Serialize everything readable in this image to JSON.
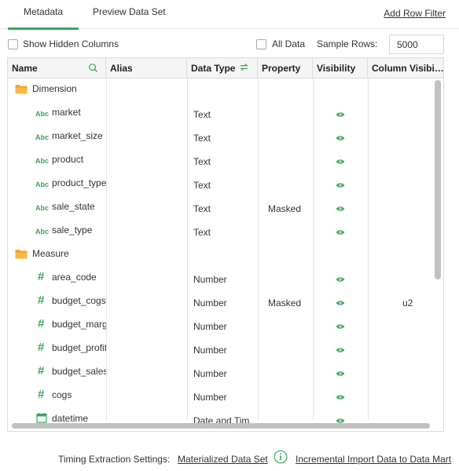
{
  "tabs": {
    "metadata": "Metadata",
    "preview": "Preview Data Set"
  },
  "add_row_filter": "Add Row Filter",
  "options": {
    "show_hidden_columns": "Show Hidden Columns",
    "all_data": "All Data",
    "sample_rows_label": "Sample Rows:",
    "sample_rows_value": "5000"
  },
  "columns": {
    "name": "Name",
    "alias": "Alias",
    "data_type": "Data Type",
    "property": "Property",
    "visibility": "Visibility",
    "column_visibility": "Column Visibi…"
  },
  "rows": [
    {
      "kind": "folder",
      "name": "Dimension"
    },
    {
      "kind": "field",
      "icon": "Abc",
      "name": "market",
      "type": "Text",
      "property": "",
      "visible": true,
      "column_visibility": ""
    },
    {
      "kind": "field",
      "icon": "Abc",
      "name": "market_size",
      "type": "Text",
      "property": "",
      "visible": true,
      "column_visibility": ""
    },
    {
      "kind": "field",
      "icon": "Abc",
      "name": "product",
      "type": "Text",
      "property": "",
      "visible": true,
      "column_visibility": ""
    },
    {
      "kind": "field",
      "icon": "Abc",
      "name": "product_type",
      "type": "Text",
      "property": "",
      "visible": true,
      "column_visibility": ""
    },
    {
      "kind": "field",
      "icon": "Abc",
      "name": "sale_state",
      "type": "Text",
      "property": "Masked",
      "visible": true,
      "column_visibility": ""
    },
    {
      "kind": "field",
      "icon": "Abc",
      "name": "sale_type",
      "type": "Text",
      "property": "",
      "visible": true,
      "column_visibility": ""
    },
    {
      "kind": "folder",
      "name": "Measure"
    },
    {
      "kind": "field",
      "icon": "#",
      "name": "area_code",
      "type": "Number",
      "property": "",
      "visible": true,
      "column_visibility": ""
    },
    {
      "kind": "field",
      "icon": "#",
      "name": "budget_cogs",
      "type": "Number",
      "property": "Masked",
      "visible": true,
      "column_visibility": "u2"
    },
    {
      "kind": "field",
      "icon": "#",
      "name": "budget_marg",
      "type": "Number",
      "property": "",
      "visible": true,
      "column_visibility": ""
    },
    {
      "kind": "field",
      "icon": "#",
      "name": "budget_profit",
      "type": "Number",
      "property": "",
      "visible": true,
      "column_visibility": ""
    },
    {
      "kind": "field",
      "icon": "#",
      "name": "budget_sales",
      "type": "Number",
      "property": "",
      "visible": true,
      "column_visibility": ""
    },
    {
      "kind": "field",
      "icon": "#",
      "name": "cogs",
      "type": "Number",
      "property": "",
      "visible": true,
      "column_visibility": ""
    },
    {
      "kind": "field",
      "icon": "calendar",
      "name": "datetime",
      "type": "Date and Tim",
      "property": "",
      "visible": true,
      "column_visibility": ""
    }
  ],
  "footer": {
    "label": "Timing Extraction Settings:",
    "materialized": "Materialized Data Set",
    "incremental": "Incremental Import Data to Data Mart"
  },
  "colors": {
    "accent": "#3ba55c",
    "folder": "#f5a623",
    "border": "#dcdcdc"
  }
}
